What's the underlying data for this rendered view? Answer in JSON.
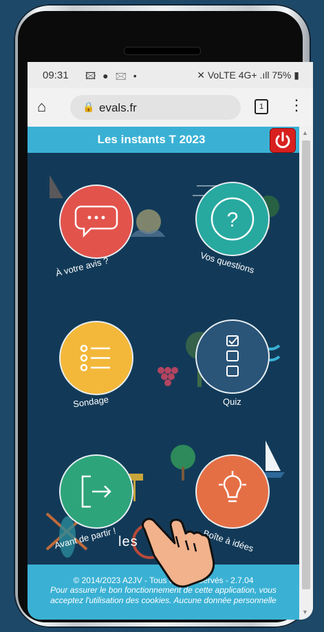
{
  "status_bar": {
    "time": "09:31",
    "notification_icons": "🖾 ● 🖂 •",
    "right_icons": "✕ VoLTE 4G+ .ıll",
    "battery": "75%"
  },
  "browser": {
    "url": "evals.fr",
    "tab_count": "1"
  },
  "app": {
    "title": "Les instants T 2023",
    "menu": [
      {
        "label": "À votre avis ?",
        "color": "#e2534c",
        "icon": "chat-bubble-icon"
      },
      {
        "label": "Vos questions",
        "color": "#27a9a0",
        "icon": "question-icon"
      },
      {
        "label": "Sondage",
        "color": "#f3b83a",
        "icon": "list-icon"
      },
      {
        "label": "Quiz",
        "color": "#2a5478",
        "icon": "checklist-icon"
      },
      {
        "label": "Avant de partir !",
        "color": "#2ea47b",
        "icon": "exit-icon"
      },
      {
        "label": "Boîte à idées",
        "color": "#e56f45",
        "icon": "lightbulb-icon"
      }
    ],
    "logo_text": "les",
    "footer": {
      "line1": "© 2014/2023 A2JV - Tous droits réservés - 2.7.04",
      "line2": "Pour assurer le bon fonctionnement de cette application, vous",
      "line3": "acceptez l'utilisation des cookies. Aucune donnée personnelle"
    }
  },
  "colors": {
    "header": "#3ab1d4",
    "background": "#123a58",
    "power_button": "#d8201f"
  }
}
